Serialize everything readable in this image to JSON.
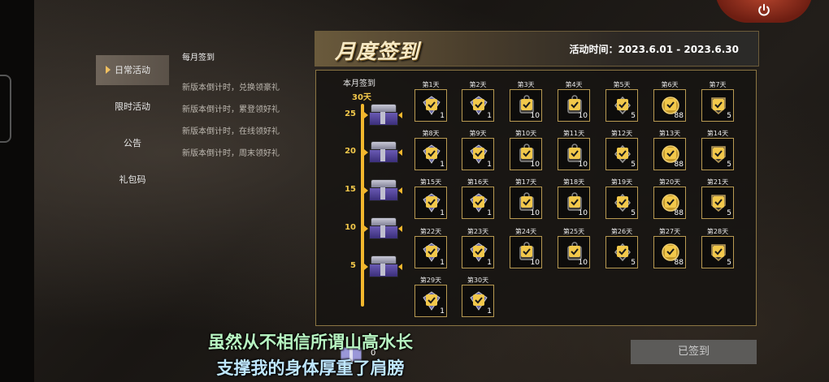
{
  "menu": {
    "items": [
      {
        "label": "日常活动",
        "active": true
      },
      {
        "label": "限时活动",
        "active": false
      },
      {
        "label": "公告",
        "active": false
      },
      {
        "label": "礼包码",
        "active": false
      }
    ]
  },
  "activities": [
    "每月签到",
    "新版本倒计时，兑换领豪礼",
    "新版本倒计时，累登领好礼",
    "新版本倒计时，在线领好礼",
    "新版本倒计时，周末领好礼"
  ],
  "banner": {
    "title": "月度签到",
    "time": "活动时间：2023.6.01 - 2023.6.30"
  },
  "progress": {
    "title": "本月签到",
    "count": "30天",
    "milestones": [
      "25",
      "20",
      "15",
      "10",
      "5"
    ]
  },
  "days": [
    {
      "label": "第1天",
      "qty": "1",
      "type": "card"
    },
    {
      "label": "第2天",
      "qty": "1",
      "type": "card"
    },
    {
      "label": "第3天",
      "qty": "10",
      "type": "tag"
    },
    {
      "label": "第4天",
      "qty": "10",
      "type": "tag"
    },
    {
      "label": "第5天",
      "qty": "5",
      "type": "key"
    },
    {
      "label": "第6天",
      "qty": "88",
      "type": "coin"
    },
    {
      "label": "第7天",
      "qty": "5",
      "type": "badge"
    },
    {
      "label": "第8天",
      "qty": "1",
      "type": "card"
    },
    {
      "label": "第9天",
      "qty": "1",
      "type": "card"
    },
    {
      "label": "第10天",
      "qty": "10",
      "type": "tag"
    },
    {
      "label": "第11天",
      "qty": "10",
      "type": "tag"
    },
    {
      "label": "第12天",
      "qty": "5",
      "type": "key"
    },
    {
      "label": "第13天",
      "qty": "88",
      "type": "coin"
    },
    {
      "label": "第14天",
      "qty": "5",
      "type": "badge"
    },
    {
      "label": "第15天",
      "qty": "1",
      "type": "card"
    },
    {
      "label": "第16天",
      "qty": "1",
      "type": "card"
    },
    {
      "label": "第17天",
      "qty": "10",
      "type": "tag"
    },
    {
      "label": "第18天",
      "qty": "10",
      "type": "tag"
    },
    {
      "label": "第19天",
      "qty": "5",
      "type": "key"
    },
    {
      "label": "第20天",
      "qty": "88",
      "type": "coin"
    },
    {
      "label": "第21天",
      "qty": "5",
      "type": "badge"
    },
    {
      "label": "第22天",
      "qty": "1",
      "type": "card"
    },
    {
      "label": "第23天",
      "qty": "1",
      "type": "card"
    },
    {
      "label": "第24天",
      "qty": "10",
      "type": "tag"
    },
    {
      "label": "第25天",
      "qty": "10",
      "type": "tag"
    },
    {
      "label": "第26天",
      "qty": "5",
      "type": "key"
    },
    {
      "label": "第27天",
      "qty": "88",
      "type": "coin"
    },
    {
      "label": "第28天",
      "qty": "5",
      "type": "badge"
    },
    {
      "label": "第29天",
      "qty": "1",
      "type": "card"
    },
    {
      "label": "第30天",
      "qty": "1",
      "type": "card"
    }
  ],
  "footer": {
    "signed_button": "已签到",
    "floating_count": "0"
  },
  "subtitles": {
    "line1": "虽然从不相信所谓山高水长",
    "line2": "支撑我的身体厚重了肩膀"
  },
  "colors": {
    "accent": "#f2b72d",
    "cell_border": "#b89a52",
    "check": "#f2c84b"
  }
}
